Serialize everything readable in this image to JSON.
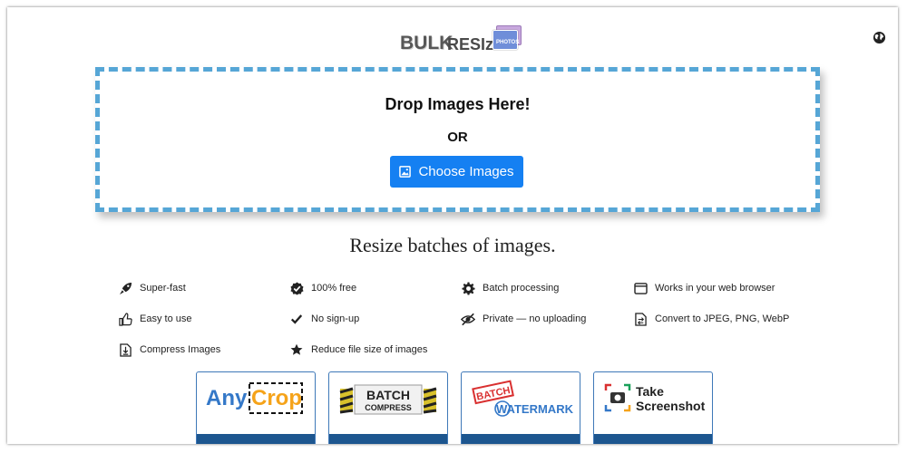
{
  "header": {
    "logo_bulk": "BULK",
    "logo_resize": "RESIze",
    "logo_photos": "PHOTOS",
    "language_icon": "globe-icon"
  },
  "dropzone": {
    "title": "Drop Images Here!",
    "or_text": "OR",
    "choose_label": "Choose Images",
    "choose_icon": "image-icon",
    "border_color": "#56a6d6",
    "button_color": "#1580f2"
  },
  "headline": "Resize batches of images.",
  "features": [
    {
      "icon": "rocket-icon",
      "label": "Super-fast"
    },
    {
      "icon": "check-badge-icon",
      "label": "100% free"
    },
    {
      "icon": "gear-icon",
      "label": "Batch processing"
    },
    {
      "icon": "browser-window-icon",
      "label": "Works in your web browser"
    },
    {
      "icon": "thumbs-up-icon",
      "label": "Easy to use"
    },
    {
      "icon": "checkmark-icon",
      "label": "No sign-up"
    },
    {
      "icon": "eye-slash-icon",
      "label": "Private — no uploading"
    },
    {
      "icon": "file-convert-icon",
      "label": "Convert to JPEG, PNG, WebP"
    },
    {
      "icon": "file-compress-icon",
      "label": "Compress Images"
    },
    {
      "icon": "star-icon",
      "label": "Reduce file size of images"
    }
  ],
  "apps": [
    {
      "name": "AnyCrop",
      "part1": "Any",
      "part2": "Crop"
    },
    {
      "name": "BATCH COMPRESS",
      "part1": "BATCH",
      "part2": "COMPRESS"
    },
    {
      "name": "BATCH WATERMARK",
      "part1": "BATCH",
      "part2": "WATERMARK"
    },
    {
      "name": "Take Screenshot",
      "part1": "Take",
      "part2": "Screenshot"
    }
  ],
  "colors": {
    "accent_blue": "#1580f2",
    "card_band": "#1d568f",
    "crop_orange": "#f5a31a",
    "crop_blue": "#3478c8"
  }
}
